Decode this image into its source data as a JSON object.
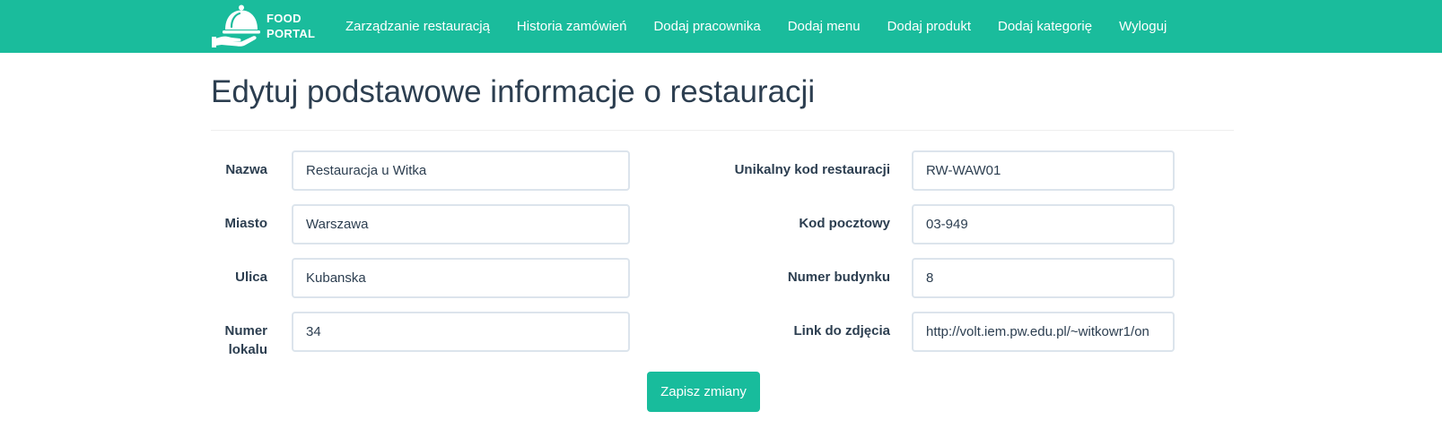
{
  "brand": {
    "line1": "FOOD",
    "line2": "PORTAL",
    "logo_icon": "cloche-hand-icon"
  },
  "nav": {
    "items": [
      {
        "label": "Zarządzanie restauracją"
      },
      {
        "label": "Historia zamówień"
      },
      {
        "label": "Dodaj pracownika"
      },
      {
        "label": "Dodaj menu"
      },
      {
        "label": "Dodaj produkt"
      },
      {
        "label": "Dodaj kategorię"
      },
      {
        "label": "Wyloguj"
      }
    ]
  },
  "page": {
    "title": "Edytuj podstawowe informacje o restauracji"
  },
  "form": {
    "name": {
      "label": "Nazwa",
      "value": "Restauracja u Witka"
    },
    "code": {
      "label": "Unikalny kod restauracji",
      "value": "RW-WAW01"
    },
    "city": {
      "label": "Miasto",
      "value": "Warszawa"
    },
    "postal": {
      "label": "Kod pocztowy",
      "value": "03-949"
    },
    "street": {
      "label": "Ulica",
      "value": "Kubanska"
    },
    "building": {
      "label": "Numer budynku",
      "value": "8"
    },
    "local": {
      "label": "Numer lokalu",
      "value": "34"
    },
    "photo": {
      "label": "Link do zdjęcia",
      "value": "http://volt.iem.pw.edu.pl/~witkowr1/on"
    },
    "save_label": "Zapisz zmiany"
  },
  "colors": {
    "navbar": "#1abc9c",
    "primary_button": "#18bc9c",
    "text": "#2c3e50",
    "input_border": "#dce4ec"
  }
}
